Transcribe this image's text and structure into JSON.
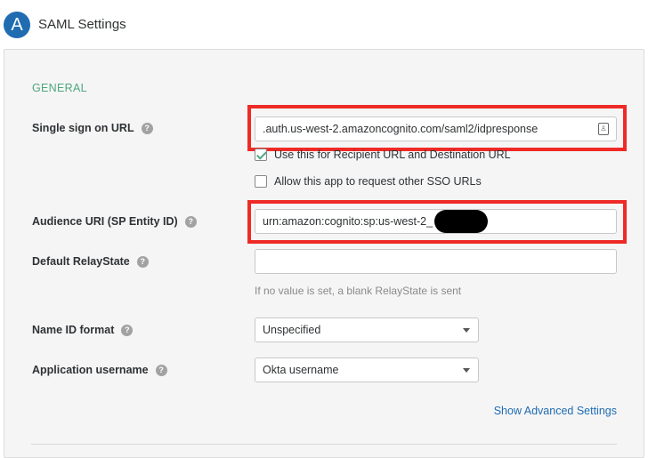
{
  "header": {
    "step": "A",
    "title": "SAML Settings"
  },
  "section": {
    "title": "GENERAL"
  },
  "fields": {
    "sso_url": {
      "label": "Single sign on URL",
      "help": "?",
      "value": ".auth.us-west-2.amazoncognito.com/saml2/idpresponse",
      "icon": "contact-card-icon"
    },
    "recipient_checkbox": {
      "label": "Use this for Recipient URL and Destination URL",
      "checked": true
    },
    "other_sso_checkbox": {
      "label": "Allow this app to request other SSO URLs",
      "checked": false
    },
    "audience_uri": {
      "label": "Audience URI (SP Entity ID)",
      "help": "?",
      "value": "urn:amazon:cognito:sp:us-west-2_"
    },
    "relay_state": {
      "label": "Default RelayState",
      "help": "?",
      "value": "",
      "hint": "If no value is set, a blank RelayState is sent"
    },
    "name_id_format": {
      "label": "Name ID format",
      "help": "?",
      "value": "Unspecified"
    },
    "app_username": {
      "label": "Application username",
      "help": "?",
      "value": "Okta username"
    }
  },
  "links": {
    "advanced": "Show Advanced Settings"
  },
  "colors": {
    "accent": "#1f6cb1",
    "section": "#4fa680",
    "highlight": "#ef2a26"
  }
}
